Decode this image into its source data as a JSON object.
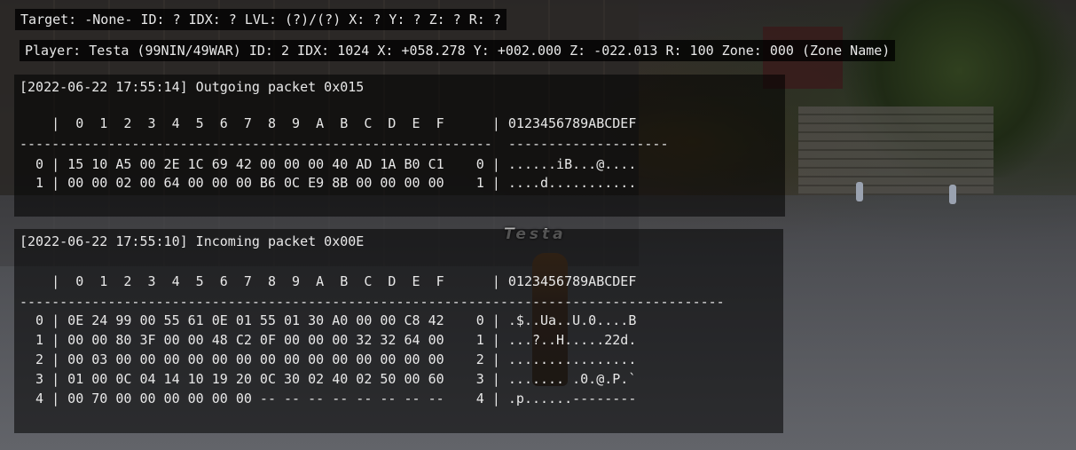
{
  "target_bar": {
    "text": "Target: -None- ID: ? IDX: ? LVL: (?)/(?) X: ? Y: ? Z: ? R: ?"
  },
  "player_bar": {
    "text": "Player: Testa (99NIN/49WAR) ID: 2 IDX: 1024 X: +058.278 Y: +002.000 Z: -022.013 R: 100 Zone: 000 (Zone Name)"
  },
  "scene": {
    "player_name": "Testa"
  },
  "packets": {
    "outgoing": {
      "header": "[2022-06-22 17:55:14] Outgoing packet 0x015",
      "column_header": "    |  0  1  2  3  4  5  6  7  8  9  A  B  C  D  E  F      | 0123456789ABCDEF",
      "divider": "-----------------------------------------------------------  --------------------",
      "rows": [
        "  0 | 15 10 A5 00 2E 1C 69 42 00 00 00 40 AD 1A B0 C1    0 | ......iB...@....",
        "  1 | 00 00 02 00 64 00 00 00 B6 0C E9 8B 00 00 00 00    1 | ....d..........."
      ]
    },
    "incoming": {
      "header": "[2022-06-22 17:55:10] Incoming packet 0x00E",
      "column_header": "    |  0  1  2  3  4  5  6  7  8  9  A  B  C  D  E  F      | 0123456789ABCDEF",
      "divider": "----------------------------------------------------------------------------------------",
      "rows": [
        "  0 | 0E 24 99 00 55 61 0E 01 55 01 30 A0 00 00 C8 42    0 | .$..Ua..U.0....B",
        "  1 | 00 00 80 3F 00 00 48 C2 0F 00 00 00 32 32 64 00    1 | ...?..H.....22d.",
        "  2 | 00 03 00 00 00 00 00 00 00 00 00 00 00 00 00 00    2 | ................",
        "  3 | 01 00 0C 04 14 10 19 20 0C 30 02 40 02 50 00 60    3 | ....... .0.@.P.`",
        "  4 | 00 70 00 00 00 00 00 00 -- -- -- -- -- -- -- --    4 | .p......--------"
      ]
    }
  }
}
